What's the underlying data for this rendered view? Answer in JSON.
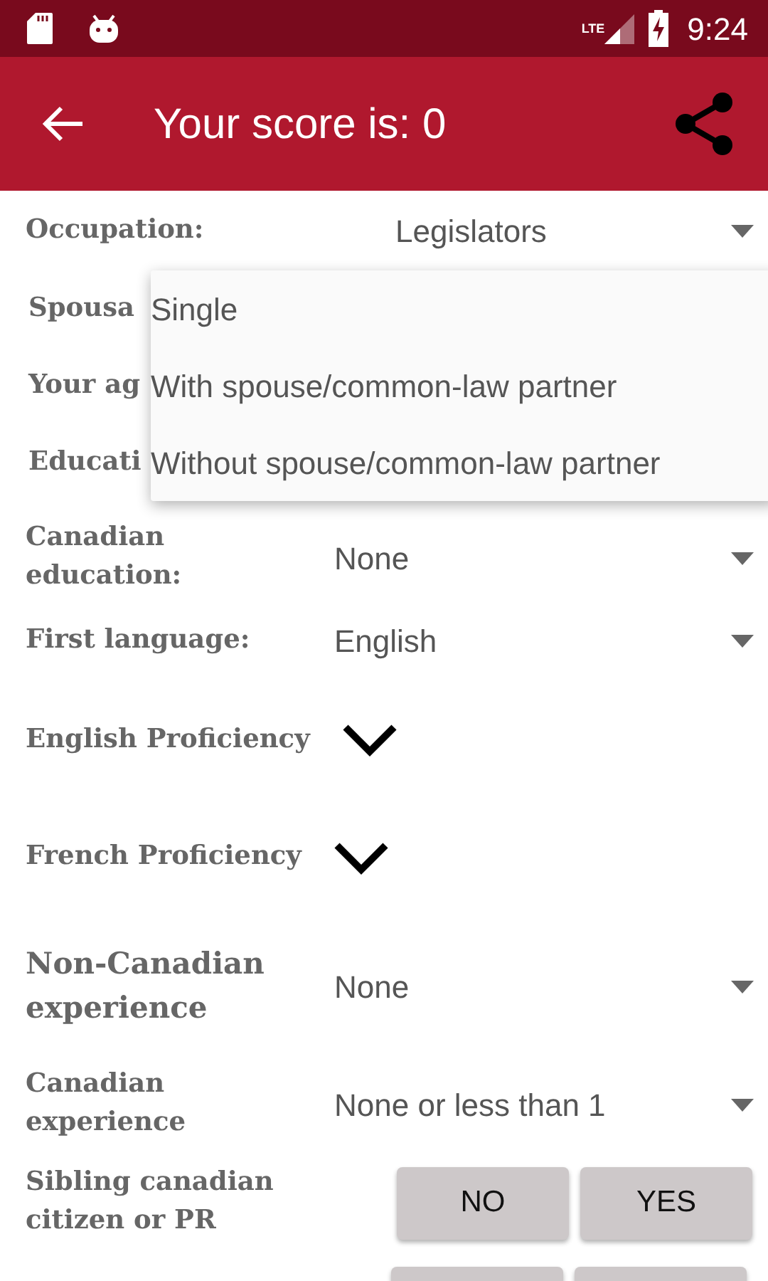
{
  "status_bar": {
    "time": "9:24",
    "network": "LTE"
  },
  "app_bar": {
    "title": "Your score is: 0"
  },
  "rows": [
    {
      "kind": "dropdown",
      "label": "Occupation:",
      "value": "Legislators",
      "wide_gap": true
    },
    {
      "kind": "covered",
      "label": "Spousa"
    },
    {
      "kind": "covered",
      "label": "Your ag"
    },
    {
      "kind": "covered",
      "label": "Educati"
    },
    {
      "kind": "dropdown",
      "label": "Canadian education:",
      "value": "None"
    },
    {
      "kind": "dropdown",
      "label": "First language:",
      "value": "English"
    },
    {
      "kind": "expander",
      "label": "English Proficiency",
      "expanded": false
    },
    {
      "kind": "expander",
      "label": "French Proficiency",
      "expanded": false
    },
    {
      "kind": "dropdown",
      "label": "Non-Canadian experience",
      "value": "None",
      "large": true
    },
    {
      "kind": "dropdown",
      "label": "Canadian experience",
      "value": "None or less than 1"
    },
    {
      "kind": "yes_no",
      "label": "Sibling canadian citizen or PR",
      "buttons": [
        {
          "label": "NO",
          "selected": false
        },
        {
          "label": "YES",
          "selected": false
        }
      ]
    },
    {
      "kind": "cut_buttons"
    }
  ],
  "popup_menu": {
    "items": [
      "Single",
      "With spouse/common-law partner",
      "Without spouse/common-law partner"
    ]
  }
}
